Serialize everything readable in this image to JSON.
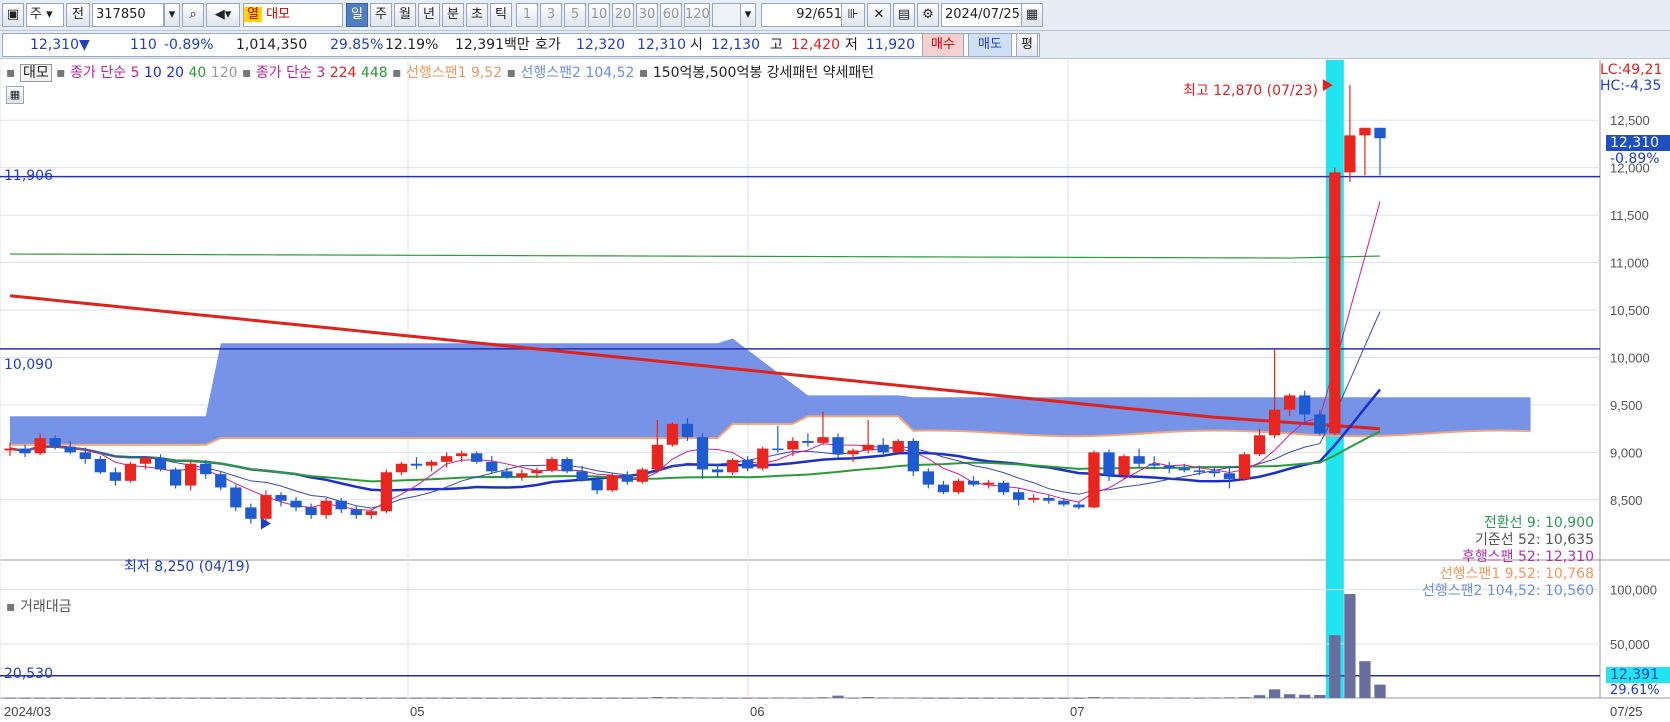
{
  "toolbar": {
    "market": "주",
    "prev": "전",
    "code": "317850",
    "category_tag": "열",
    "name": "대모",
    "periods": [
      "일",
      "주",
      "월",
      "년",
      "분",
      "초",
      "틱"
    ],
    "selected_period": "일",
    "intervals": [
      "1",
      "3",
      "5",
      "10",
      "20",
      "30",
      "60",
      "120"
    ],
    "count": "92",
    "total": "/651",
    "date": "2024/07/25"
  },
  "quote": {
    "price": "12,310",
    "change": "110",
    "change_pct": "-0.89%",
    "volume": "1,014,350",
    "turnover_pct": "29.85%",
    "ratio": "12.19%",
    "amount": "12,391백만",
    "bid_label": "호가",
    "bid1": "12,320",
    "bid2": "12,310",
    "open_label": "시",
    "open": "12,130",
    "high_label": "고",
    "high": "12,420",
    "low_label": "저",
    "low": "11,920",
    "buy": "매수",
    "sell": "매도",
    "eval": "평"
  },
  "legend": {
    "name": "대모",
    "ma_label": "종가 단순",
    "ma_periods": [
      "5",
      "10",
      "20",
      "40",
      "120"
    ],
    "ma2_label": "종가 단순",
    "ma2_periods": [
      "3",
      "224",
      "448"
    ],
    "span1": "선행스팬1 9,52",
    "span2": "선행스팬2 104,52",
    "pattern": "150억봉,500억봉 강세패턴  약세패턴",
    "volume_panel": "거래대금"
  },
  "colors": {
    "up": "#e8261f",
    "down": "#1f5bd0",
    "cloud": "#6f8de6",
    "span1": "#f2a47a",
    "ma_red": "#e0221d",
    "ma_blue": "#1b2fc9",
    "ma_green": "#2c9a3a",
    "cyan": "#22e3f0",
    "vol": "#6a6e9e",
    "hline": "#2a2fa6"
  },
  "annotations": {
    "high": "최고 12,870 (07/23)",
    "low": "최저 8,250 (04/19)",
    "hline1": "11,906",
    "hline2": "10,090",
    "vol_line": "20,530",
    "lc": "LC:49,21",
    "hc": "HC:-4,35",
    "price_tag": "12,310",
    "pct_tag": "-0.89%",
    "vol_tag": "12,391",
    "vol_pct": "29.61%",
    "ichimoku": [
      {
        "text": "전환선 9: 10,900",
        "color": "#2a9a55"
      },
      {
        "text": "기준선 52: 10,635",
        "color": "#555555"
      },
      {
        "text": "후행스팬 52: 12,310",
        "color": "#b030b0"
      },
      {
        "text": "선행스팬1 9,52: 10,768",
        "color": "#f09860"
      },
      {
        "text": "선행스팬2 104,52: 10,560",
        "color": "#6f8de6"
      }
    ]
  },
  "chart_data": {
    "type": "candlestick",
    "price_ticks": [
      "12,500",
      "12,000",
      "11,500",
      "11,000",
      "10,500",
      "10,000",
      "9,500",
      "9,000",
      "8,500"
    ],
    "volume_ticks": [
      "100,000",
      "50,000"
    ],
    "x_labels": [
      "2024/03",
      "05",
      "06",
      "07"
    ],
    "last_date": "07/25",
    "y_range": [
      7950,
      13050
    ],
    "candles": [
      [
        9020,
        9100,
        8960,
        9040
      ],
      [
        9040,
        9080,
        8950,
        8990
      ],
      [
        8990,
        9200,
        8970,
        9150
      ],
      [
        9150,
        9180,
        9030,
        9060
      ],
      [
        9060,
        9120,
        8980,
        9000
      ],
      [
        9000,
        9050,
        8880,
        8930
      ],
      [
        8930,
        8960,
        8770,
        8790
      ],
      [
        8790,
        8840,
        8650,
        8700
      ],
      [
        8700,
        8900,
        8680,
        8880
      ],
      [
        8880,
        8960,
        8820,
        8940
      ],
      [
        8940,
        8980,
        8800,
        8820
      ],
      [
        8820,
        8840,
        8620,
        8650
      ],
      [
        8650,
        8920,
        8600,
        8880
      ],
      [
        8880,
        8920,
        8720,
        8770
      ],
      [
        8770,
        8800,
        8600,
        8630
      ],
      [
        8630,
        8660,
        8380,
        8420
      ],
      [
        8420,
        8460,
        8250,
        8300
      ],
      [
        8300,
        8600,
        8260,
        8550
      ],
      [
        8550,
        8580,
        8430,
        8490
      ],
      [
        8490,
        8530,
        8380,
        8420
      ],
      [
        8420,
        8460,
        8300,
        8340
      ],
      [
        8340,
        8520,
        8300,
        8490
      ],
      [
        8490,
        8520,
        8360,
        8400
      ],
      [
        8400,
        8440,
        8300,
        8340
      ],
      [
        8340,
        8400,
        8300,
        8380
      ],
      [
        8380,
        8820,
        8360,
        8790
      ],
      [
        8790,
        8900,
        8760,
        8880
      ],
      [
        8880,
        8950,
        8820,
        8860
      ],
      [
        8860,
        8920,
        8800,
        8900
      ],
      [
        8900,
        9000,
        8840,
        8960
      ],
      [
        8960,
        9020,
        8900,
        8990
      ],
      [
        8990,
        9010,
        8880,
        8900
      ],
      [
        8900,
        8960,
        8780,
        8800
      ],
      [
        8800,
        8840,
        8720,
        8740
      ],
      [
        8740,
        8820,
        8700,
        8780
      ],
      [
        8780,
        8840,
        8730,
        8810
      ],
      [
        8810,
        8950,
        8790,
        8930
      ],
      [
        8930,
        8950,
        8780,
        8800
      ],
      [
        8800,
        8860,
        8690,
        8710
      ],
      [
        8710,
        8740,
        8560,
        8600
      ],
      [
        8600,
        8780,
        8580,
        8760
      ],
      [
        8760,
        8800,
        8660,
        8690
      ],
      [
        8690,
        8840,
        8670,
        8820
      ],
      [
        8820,
        9340,
        8800,
        9080
      ],
      [
        9080,
        9320,
        9060,
        9300
      ],
      [
        9300,
        9360,
        9120,
        9160
      ],
      [
        9160,
        9200,
        8720,
        8820
      ],
      [
        8820,
        8870,
        8740,
        8790
      ],
      [
        8790,
        8940,
        8760,
        8920
      ],
      [
        8920,
        8960,
        8800,
        8830
      ],
      [
        8830,
        9060,
        8810,
        9040
      ],
      [
        9040,
        9280,
        9000,
        9030
      ],
      [
        9030,
        9160,
        8960,
        9120
      ],
      [
        9120,
        9200,
        9060,
        9100
      ],
      [
        9100,
        9430,
        9080,
        9160
      ],
      [
        9160,
        9200,
        8940,
        8980
      ],
      [
        8980,
        9040,
        8900,
        9020
      ],
      [
        9020,
        9340,
        8990,
        9080
      ],
      [
        9080,
        9150,
        8980,
        9000
      ],
      [
        9000,
        9140,
        8990,
        9120
      ],
      [
        9120,
        9150,
        8750,
        8800
      ],
      [
        8800,
        8830,
        8620,
        8660
      ],
      [
        8660,
        8700,
        8560,
        8580
      ],
      [
        8580,
        8720,
        8560,
        8700
      ],
      [
        8700,
        8750,
        8640,
        8660
      ],
      [
        8660,
        8710,
        8620,
        8680
      ],
      [
        8680,
        8700,
        8550,
        8580
      ],
      [
        8580,
        8620,
        8440,
        8500
      ],
      [
        8500,
        8560,
        8470,
        8520
      ],
      [
        8520,
        8550,
        8460,
        8490
      ],
      [
        8490,
        8520,
        8430,
        8450
      ],
      [
        8450,
        8480,
        8400,
        8420
      ],
      [
        8420,
        9020,
        8410,
        9000
      ],
      [
        9000,
        9030,
        8700,
        8760
      ],
      [
        8760,
        8980,
        8720,
        8960
      ],
      [
        8960,
        9040,
        8840,
        8880
      ],
      [
        8880,
        8960,
        8820,
        8860
      ],
      [
        8860,
        8900,
        8780,
        8830
      ],
      [
        8830,
        8880,
        8790,
        8810
      ],
      [
        8810,
        8860,
        8760,
        8800
      ],
      [
        8800,
        8850,
        8740,
        8780
      ],
      [
        8780,
        8850,
        8620,
        8720
      ],
      [
        8720,
        9000,
        8700,
        8980
      ],
      [
        8980,
        9250,
        8960,
        9180
      ],
      [
        9180,
        10090,
        9150,
        9450
      ],
      [
        9450,
        9620,
        9380,
        9600
      ],
      [
        9600,
        9650,
        9300,
        9400
      ],
      [
        9400,
        9450,
        9180,
        9200
      ],
      [
        9200,
        12000,
        9180,
        11950
      ],
      [
        11950,
        12870,
        11850,
        12340
      ],
      [
        12340,
        12420,
        11920,
        12420
      ],
      [
        12420,
        12420,
        11920,
        12310
      ]
    ],
    "volume": [
      300,
      250,
      280,
      240,
      260,
      220,
      200,
      210,
      260,
      230,
      220,
      240,
      280,
      230,
      210,
      260,
      310,
      300,
      250,
      230,
      220,
      260,
      240,
      230,
      220,
      300,
      280,
      260,
      240,
      270,
      260,
      250,
      220,
      210,
      230,
      240,
      300,
      260,
      220,
      210,
      230,
      220,
      250,
      900,
      700,
      600,
      400,
      300,
      320,
      280,
      350,
      500,
      400,
      380,
      700,
      2200,
      380,
      900,
      500,
      480,
      420,
      300,
      260,
      280,
      260,
      270,
      300,
      250,
      240,
      230,
      220,
      240,
      900,
      600,
      500,
      450,
      420,
      380,
      400,
      350,
      500,
      600,
      800,
      2600,
      8000,
      3500,
      3000,
      2800,
      58000,
      96000,
      34000,
      12391
    ],
    "volume_range": [
      0,
      120000
    ]
  }
}
